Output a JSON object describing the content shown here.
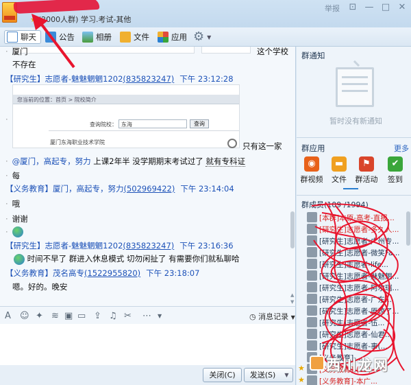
{
  "window": {
    "group_meta": "(2000人群) 学习.考试-其他",
    "report": "举报",
    "controls": {
      "skin": "⊡",
      "minimize": "—",
      "maximize": "□",
      "close": "✕"
    }
  },
  "toolbar": {
    "chat": "聊天",
    "notice": "公告",
    "album": "相册",
    "files": "文件",
    "apps": "应用"
  },
  "chat": {
    "top_lines": {
      "xiamen": "厦门",
      "no_school": "这个学校",
      "not_exist": "不存在"
    },
    "msg1": {
      "role": "【研究生】",
      "nick": "志愿者-魅魅魍魍1202",
      "qq": "(835823247)",
      "time": "下午 23:12:28"
    },
    "shot": {
      "breadcrumb": "您当前的位置：首页 > 院校简介",
      "search_label": "查询院校：",
      "search_value": "东海",
      "search_button": "查询",
      "result": "厦门东海职业技术学院"
    },
    "only_this": "只有这一家",
    "line_mention": {
      "mention": "@厦门，高起专，努力",
      "text_a": " 上课2年半  没学期期末考试过了  ",
      "text_b": "就有专科证"
    },
    "line_mei": "每",
    "msg2": {
      "role": "【义务教育】",
      "nick": "厦门，高起专，努力",
      "qq": "(502969422)",
      "time": "下午 23:14:04"
    },
    "line_oh": "哦",
    "line_thanks": "谢谢",
    "msg3": {
      "role": "【研究生】",
      "nick": "志愿者-魅魅魍魍1202",
      "qq": "(835823247)",
      "time": "下午 23:16:36"
    },
    "line_late": "时间不早了  群进入休息模式    切勿闲扯了   有需要你们就私聊哈",
    "msg4": {
      "role": "【义务教育】",
      "nick": "茂名高专",
      "qq": "(1522955820)",
      "time": "下午 23:18:07"
    },
    "line_ok": "嗯。好的。晚安"
  },
  "input_toolbar": {
    "history": "消息记录"
  },
  "buttons": {
    "close": "关闭(C)",
    "send": "发送(S)"
  },
  "right": {
    "notice_title": "群通知",
    "empty_notice": "暂时没有新通知",
    "apps_title": "群应用",
    "more": "更多",
    "apps": [
      {
        "label": "群视频",
        "color": "#e8611a"
      },
      {
        "label": "文件",
        "color": "#f0a020"
      },
      {
        "label": "群活动",
        "color": "#d9452b"
      },
      {
        "label": "签到",
        "color": "#3aa63a"
      }
    ],
    "members_title": "群成员(109 /1994)",
    "members": [
      {
        "name": "[本群]本原-高考-直报...",
        "red": true,
        "star": false
      },
      {
        "name": "[研究生]志愿者-多久人...",
        "red": true,
        "star": false
      },
      {
        "name": "[研究生]志愿者-广州专...",
        "red": false,
        "star": false
      },
      {
        "name": "[研究生]志愿者-微笑Fa...",
        "red": false,
        "star": false
      },
      {
        "name": "[研究生]志愿者-life...",
        "red": false,
        "star": false
      },
      {
        "name": "[研究生]志愿者-魅魅魍...",
        "red": false,
        "star": false
      },
      {
        "name": "[研究生]志愿者-阿尔瑞...",
        "red": false,
        "star": false
      },
      {
        "name": "[研究生]志愿者-广东...",
        "red": false,
        "star": false
      },
      {
        "name": "[研究生]志愿者-原谅了...",
        "red": false,
        "star": false
      },
      {
        "name": "[研究生]志愿者-伍...",
        "red": false,
        "star": false
      },
      {
        "name": "[研究生]志愿者-仙君...",
        "red": false,
        "star": false
      },
      {
        "name": "[研究生]志愿者-事(...",
        "red": false,
        "star": false
      },
      {
        "name": "[义务教育]-...",
        "red": false,
        "star": false
      },
      {
        "name": "[义务教育]-(35)",
        "red": true,
        "star": true
      },
      {
        "name": "[义务教育]-本广...",
        "red": true,
        "star": true
      },
      {
        "name": "[义务教育]-...",
        "red": false,
        "star": true
      }
    ]
  },
  "watermark": {
    "text": "西川龙网"
  }
}
